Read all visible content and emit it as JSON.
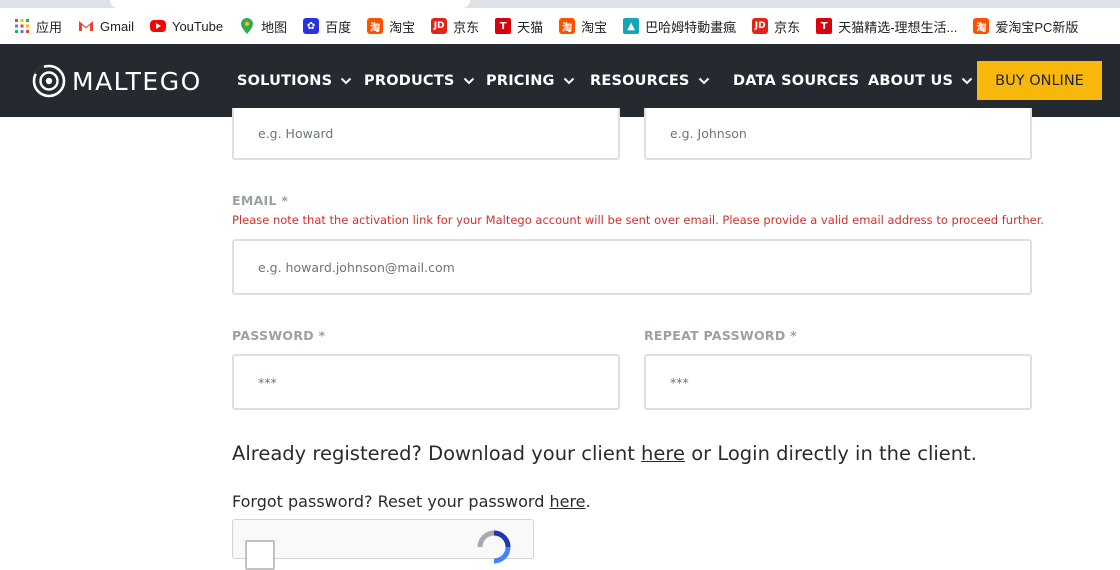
{
  "bookmarks": [
    {
      "label": "应用",
      "icon": "apps-grid-icon"
    },
    {
      "label": "Gmail",
      "icon": "gmail-icon"
    },
    {
      "label": "YouTube",
      "icon": "youtube-icon"
    },
    {
      "label": "地图",
      "icon": "maps-pin-icon"
    },
    {
      "label": "百度",
      "icon": "baidu-icon"
    },
    {
      "label": "淘宝",
      "icon": "taobao-icon"
    },
    {
      "label": "京东",
      "icon": "jd-icon"
    },
    {
      "label": "天猫",
      "icon": "tmall-icon"
    },
    {
      "label": "淘宝",
      "icon": "taobao-icon"
    },
    {
      "label": "巴哈姆特動畫瘋",
      "icon": "bahamut-icon"
    },
    {
      "label": "京东",
      "icon": "jd-icon"
    },
    {
      "label": "天猫精选-理想生活...",
      "icon": "tmall-icon"
    },
    {
      "label": "爱淘宝PC新版",
      "icon": "taobao-icon"
    }
  ],
  "nav": {
    "logo_text": "MALTEGO",
    "items": [
      {
        "label": "SOLUTIONS"
      },
      {
        "label": "PRODUCTS"
      },
      {
        "label": "PRICING"
      },
      {
        "label": "RESOURCES"
      },
      {
        "label": "DATA SOURCES"
      },
      {
        "label": "ABOUT US"
      }
    ],
    "buy_label": "BUY ONLINE"
  },
  "form": {
    "first_name_placeholder": "e.g. Howard",
    "last_name_placeholder": "e.g. Johnson",
    "email_label": "EMAIL *",
    "email_note": "Please note that the activation link for your Maltego account will be sent over email. Please provide a valid email address to proceed further.",
    "email_placeholder": "e.g. howard.johnson@mail.com",
    "password_label": "PASSWORD *",
    "password_placeholder": "***",
    "repeat_password_label": "REPEAT PASSWORD *",
    "repeat_password_placeholder": "***"
  },
  "footer_text": {
    "registered_prefix": "Already registered? Download your client",
    "registered_link": "here",
    "registered_suffix": "or Login directly in the client.",
    "forgot_prefix": "Forgot password? Reset your password",
    "forgot_link": "here",
    "forgot_suffix": "."
  },
  "colors": {
    "nav_bg": "#252a31",
    "buy_button": "#f7b70b",
    "note_red": "#d0312d",
    "label_gray": "#9aa0a6"
  }
}
